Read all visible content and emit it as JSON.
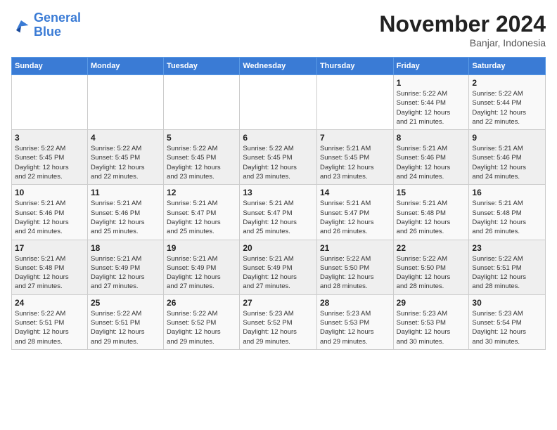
{
  "logo": {
    "line1": "General",
    "line2": "Blue"
  },
  "title": "November 2024",
  "location": "Banjar, Indonesia",
  "days_header": [
    "Sunday",
    "Monday",
    "Tuesday",
    "Wednesday",
    "Thursday",
    "Friday",
    "Saturday"
  ],
  "weeks": [
    [
      {
        "day": "",
        "info": ""
      },
      {
        "day": "",
        "info": ""
      },
      {
        "day": "",
        "info": ""
      },
      {
        "day": "",
        "info": ""
      },
      {
        "day": "",
        "info": ""
      },
      {
        "day": "1",
        "info": "Sunrise: 5:22 AM\nSunset: 5:44 PM\nDaylight: 12 hours\nand 21 minutes."
      },
      {
        "day": "2",
        "info": "Sunrise: 5:22 AM\nSunset: 5:44 PM\nDaylight: 12 hours\nand 22 minutes."
      }
    ],
    [
      {
        "day": "3",
        "info": "Sunrise: 5:22 AM\nSunset: 5:45 PM\nDaylight: 12 hours\nand 22 minutes."
      },
      {
        "day": "4",
        "info": "Sunrise: 5:22 AM\nSunset: 5:45 PM\nDaylight: 12 hours\nand 22 minutes."
      },
      {
        "day": "5",
        "info": "Sunrise: 5:22 AM\nSunset: 5:45 PM\nDaylight: 12 hours\nand 23 minutes."
      },
      {
        "day": "6",
        "info": "Sunrise: 5:22 AM\nSunset: 5:45 PM\nDaylight: 12 hours\nand 23 minutes."
      },
      {
        "day": "7",
        "info": "Sunrise: 5:21 AM\nSunset: 5:45 PM\nDaylight: 12 hours\nand 23 minutes."
      },
      {
        "day": "8",
        "info": "Sunrise: 5:21 AM\nSunset: 5:46 PM\nDaylight: 12 hours\nand 24 minutes."
      },
      {
        "day": "9",
        "info": "Sunrise: 5:21 AM\nSunset: 5:46 PM\nDaylight: 12 hours\nand 24 minutes."
      }
    ],
    [
      {
        "day": "10",
        "info": "Sunrise: 5:21 AM\nSunset: 5:46 PM\nDaylight: 12 hours\nand 24 minutes."
      },
      {
        "day": "11",
        "info": "Sunrise: 5:21 AM\nSunset: 5:46 PM\nDaylight: 12 hours\nand 25 minutes."
      },
      {
        "day": "12",
        "info": "Sunrise: 5:21 AM\nSunset: 5:47 PM\nDaylight: 12 hours\nand 25 minutes."
      },
      {
        "day": "13",
        "info": "Sunrise: 5:21 AM\nSunset: 5:47 PM\nDaylight: 12 hours\nand 25 minutes."
      },
      {
        "day": "14",
        "info": "Sunrise: 5:21 AM\nSunset: 5:47 PM\nDaylight: 12 hours\nand 26 minutes."
      },
      {
        "day": "15",
        "info": "Sunrise: 5:21 AM\nSunset: 5:48 PM\nDaylight: 12 hours\nand 26 minutes."
      },
      {
        "day": "16",
        "info": "Sunrise: 5:21 AM\nSunset: 5:48 PM\nDaylight: 12 hours\nand 26 minutes."
      }
    ],
    [
      {
        "day": "17",
        "info": "Sunrise: 5:21 AM\nSunset: 5:48 PM\nDaylight: 12 hours\nand 27 minutes."
      },
      {
        "day": "18",
        "info": "Sunrise: 5:21 AM\nSunset: 5:49 PM\nDaylight: 12 hours\nand 27 minutes."
      },
      {
        "day": "19",
        "info": "Sunrise: 5:21 AM\nSunset: 5:49 PM\nDaylight: 12 hours\nand 27 minutes."
      },
      {
        "day": "20",
        "info": "Sunrise: 5:21 AM\nSunset: 5:49 PM\nDaylight: 12 hours\nand 27 minutes."
      },
      {
        "day": "21",
        "info": "Sunrise: 5:22 AM\nSunset: 5:50 PM\nDaylight: 12 hours\nand 28 minutes."
      },
      {
        "day": "22",
        "info": "Sunrise: 5:22 AM\nSunset: 5:50 PM\nDaylight: 12 hours\nand 28 minutes."
      },
      {
        "day": "23",
        "info": "Sunrise: 5:22 AM\nSunset: 5:51 PM\nDaylight: 12 hours\nand 28 minutes."
      }
    ],
    [
      {
        "day": "24",
        "info": "Sunrise: 5:22 AM\nSunset: 5:51 PM\nDaylight: 12 hours\nand 28 minutes."
      },
      {
        "day": "25",
        "info": "Sunrise: 5:22 AM\nSunset: 5:51 PM\nDaylight: 12 hours\nand 29 minutes."
      },
      {
        "day": "26",
        "info": "Sunrise: 5:22 AM\nSunset: 5:52 PM\nDaylight: 12 hours\nand 29 minutes."
      },
      {
        "day": "27",
        "info": "Sunrise: 5:23 AM\nSunset: 5:52 PM\nDaylight: 12 hours\nand 29 minutes."
      },
      {
        "day": "28",
        "info": "Sunrise: 5:23 AM\nSunset: 5:53 PM\nDaylight: 12 hours\nand 29 minutes."
      },
      {
        "day": "29",
        "info": "Sunrise: 5:23 AM\nSunset: 5:53 PM\nDaylight: 12 hours\nand 30 minutes."
      },
      {
        "day": "30",
        "info": "Sunrise: 5:23 AM\nSunset: 5:54 PM\nDaylight: 12 hours\nand 30 minutes."
      }
    ]
  ]
}
